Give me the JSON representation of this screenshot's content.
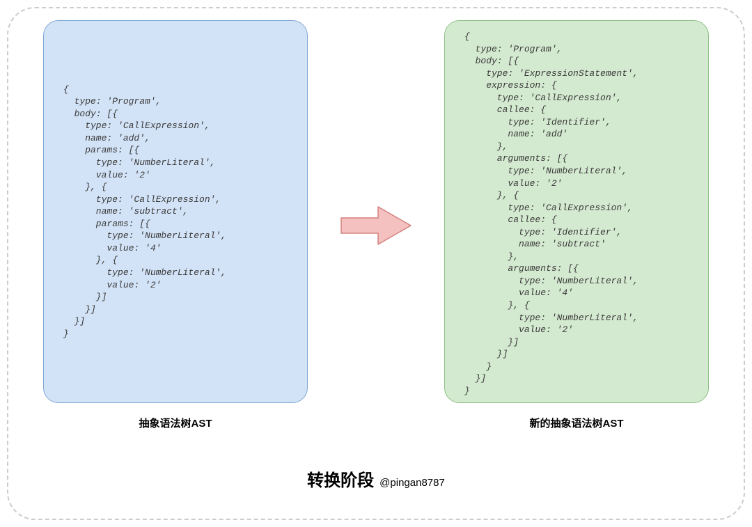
{
  "left": {
    "code": "{\n  type: 'Program',\n  body: [{\n    type: 'CallExpression',\n    name: 'add',\n    params: [{\n      type: 'NumberLiteral',\n      value: '2'\n    }, {\n      type: 'CallExpression',\n      name: 'subtract',\n      params: [{\n        type: 'NumberLiteral',\n        value: '4'\n      }, {\n        type: 'NumberLiteral',\n        value: '2'\n      }]\n    }]\n  }]\n}",
    "label": "抽象语法树AST"
  },
  "right": {
    "code": "{\n  type: 'Program',\n  body: [{\n    type: 'ExpressionStatement',\n    expression: {\n      type: 'CallExpression',\n      callee: {\n        type: 'Identifier',\n        name: 'add'\n      },\n      arguments: [{\n        type: 'NumberLiteral',\n        value: '2'\n      }, {\n        type: 'CallExpression',\n        callee: {\n          type: 'Identifier',\n          name: 'subtract'\n        },\n        arguments: [{\n          type: 'NumberLiteral',\n          value: '4'\n        }, {\n          type: 'NumberLiteral',\n          value: '2'\n        }]\n      }]\n    }\n  }]\n}",
    "label": "新的抽象语法树AST"
  },
  "footer": {
    "main": "转换阶段",
    "sub": "@pingan8787"
  },
  "colors": {
    "left_bg": "#d3e3f7",
    "left_border": "#7fa8d6",
    "right_bg": "#d4ead0",
    "right_border": "#8cc084",
    "arrow_fill": "#f4c1c0",
    "arrow_stroke": "#d48080"
  }
}
